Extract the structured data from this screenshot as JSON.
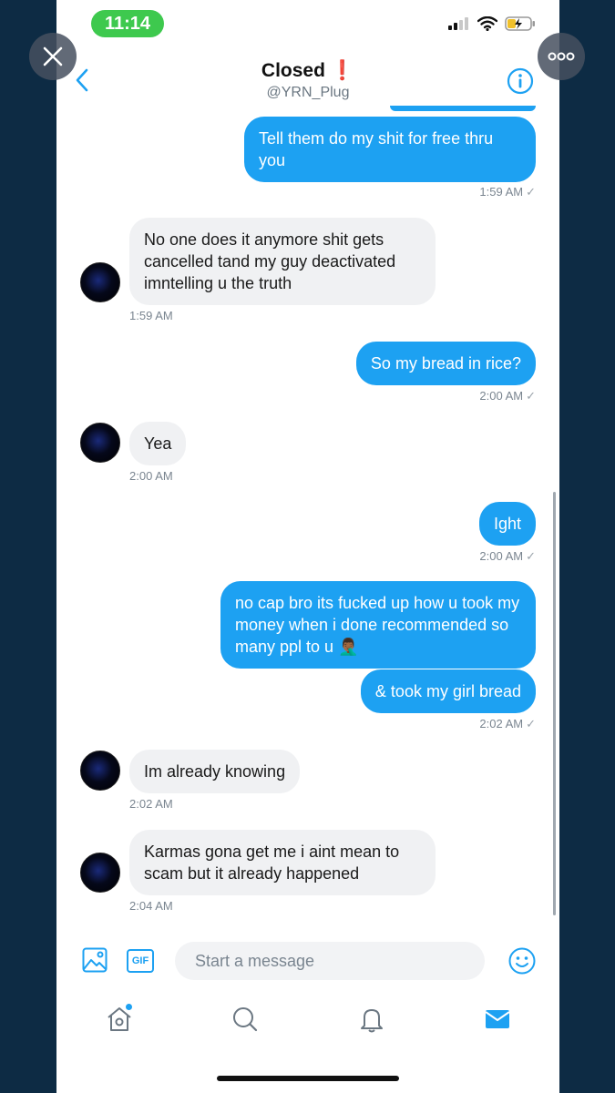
{
  "status": {
    "time": "11:14"
  },
  "header": {
    "title": "Closed",
    "handle": "@YRN_Plug"
  },
  "messages": [
    {
      "side": "out",
      "text": "Tell them do my shit for free thru you",
      "time": "1:59 AM"
    },
    {
      "side": "in",
      "text": "No one does it anymore shit gets cancelled tand my guy deactivated imntelling u the truth",
      "time": "1:59 AM"
    },
    {
      "side": "out",
      "text": "So my bread in rice?",
      "time": "2:00 AM"
    },
    {
      "side": "in",
      "text": "Yea",
      "time": "2:00 AM"
    },
    {
      "side": "out",
      "text": "Ight",
      "time": "2:00 AM"
    },
    {
      "side": "out",
      "text": "no cap bro its fucked up how u took my money when i done recommended so many ppl to u 🤦🏾‍♂️"
    },
    {
      "side": "out",
      "text": "& took my girl bread",
      "time": "2:02 AM"
    },
    {
      "side": "in",
      "text": "Im already knowing",
      "time": "2:02 AM"
    },
    {
      "side": "in",
      "text": "Karmas gona get me i aint mean to scam but it already happened",
      "time": "2:04 AM"
    }
  ],
  "composer": {
    "gif_label": "GIF",
    "placeholder": "Start a message"
  },
  "tabs": [
    "home",
    "search",
    "notifications",
    "messages"
  ],
  "colors": {
    "accent": "#1da1f2",
    "incoming_bubble": "#f0f1f3",
    "status_time_bg": "#3ec94e"
  }
}
